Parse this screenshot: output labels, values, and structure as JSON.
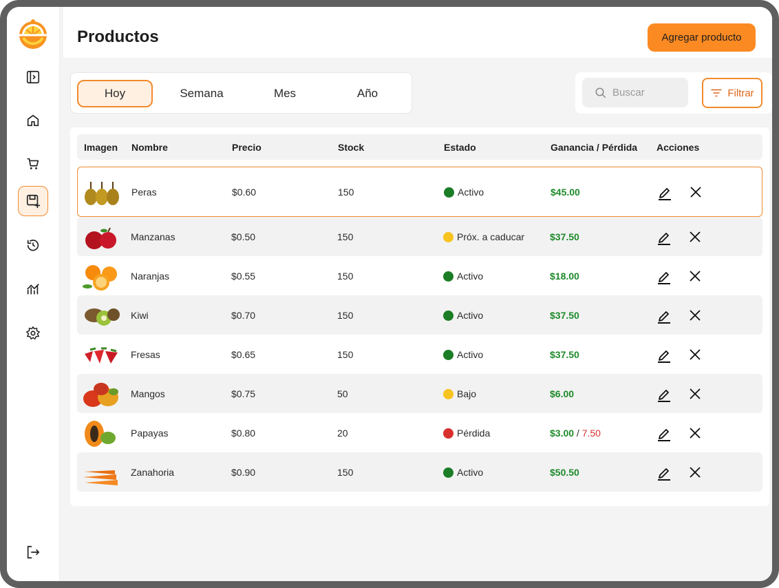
{
  "header": {
    "title": "Productos",
    "add_button": "Agregar producto"
  },
  "tabs": [
    {
      "label": "Hoy",
      "active": true
    },
    {
      "label": "Semana",
      "active": false
    },
    {
      "label": "Mes",
      "active": false
    },
    {
      "label": "Año",
      "active": false
    }
  ],
  "search": {
    "placeholder": "Buscar",
    "value": ""
  },
  "filter_button": "Filtrar",
  "sidebar": {
    "items": [
      {
        "icon": "sidebar-toggle-icon"
      },
      {
        "icon": "home-icon"
      },
      {
        "icon": "cart-icon"
      },
      {
        "icon": "add-product-icon",
        "active": true
      },
      {
        "icon": "history-icon"
      },
      {
        "icon": "analytics-icon"
      },
      {
        "icon": "settings-icon"
      }
    ],
    "logout": {
      "icon": "logout-icon"
    }
  },
  "table": {
    "columns": [
      "Imagen",
      "Nombre",
      "Precio",
      "Stock",
      "Estado",
      "Ganancia / Pérdida",
      "Acciones"
    ],
    "rows": [
      {
        "name": "Peras",
        "price": "$0.60",
        "stock": "150",
        "status": "Activo",
        "status_color": "#1b7d26",
        "profit": "$45.00",
        "loss": "",
        "image": "pear"
      },
      {
        "name": "Manzanas",
        "price": "$0.50",
        "stock": "150",
        "status": "Próx. a caducar",
        "status_color": "#f7c31f",
        "profit": "$37.50",
        "loss": "",
        "image": "apple"
      },
      {
        "name": "Naranjas",
        "price": "$0.55",
        "stock": "150",
        "status": "Activo",
        "status_color": "#1b7d26",
        "profit": "$18.00",
        "loss": "",
        "image": "orange"
      },
      {
        "name": "Kiwi",
        "price": "$0.70",
        "stock": "150",
        "status": "Activo",
        "status_color": "#1b7d26",
        "profit": "$37.50",
        "loss": "",
        "image": "kiwi"
      },
      {
        "name": "Fresas",
        "price": "$0.65",
        "stock": "150",
        "status": "Activo",
        "status_color": "#1b7d26",
        "profit": "$37.50",
        "loss": "",
        "image": "strawberry"
      },
      {
        "name": "Mangos",
        "price": "$0.75",
        "stock": "50",
        "status": "Bajo",
        "status_color": "#f7c31f",
        "profit": "$6.00",
        "loss": "",
        "image": "mango"
      },
      {
        "name": "Papayas",
        "price": "$0.80",
        "stock": "20",
        "status": "Pérdida",
        "status_color": "#d8302e",
        "profit": "$3.00",
        "loss": "7.50",
        "image": "papaya"
      },
      {
        "name": "Zanahoria",
        "price": "$0.90",
        "stock": "150",
        "status": "Activo",
        "status_color": "#1b7d26",
        "profit": "$50.50",
        "loss": "",
        "image": "carrot"
      }
    ]
  },
  "colors": {
    "accent": "#fb8a22",
    "accent_border": "#f28a2d",
    "profit": "#1e8a2a",
    "loss": "#d8302e"
  }
}
